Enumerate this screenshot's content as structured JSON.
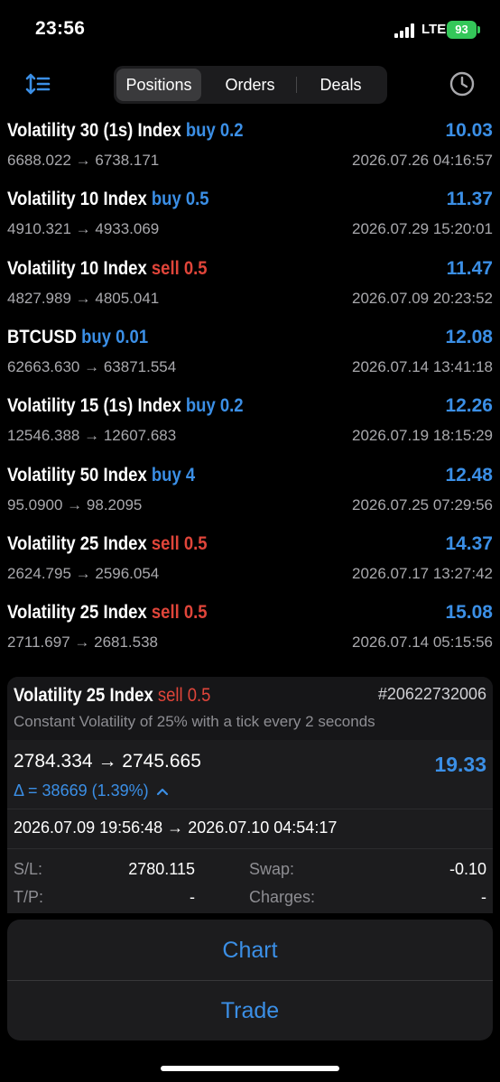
{
  "status_bar": {
    "time": "23:56",
    "network": "LTE",
    "battery": "93"
  },
  "tabs": {
    "positions": "Positions",
    "orders": "Orders",
    "deals": "Deals",
    "active": "positions"
  },
  "positions": [
    {
      "symbol": "Volatility 30 (1s) Index",
      "dir": "buy",
      "dir_label": "buy 0.2",
      "open": "6688.022",
      "current": "6738.171",
      "profit": "10.03",
      "datetime": "2026.07.26 04:16:57"
    },
    {
      "symbol": "Volatility 10 Index",
      "dir": "buy",
      "dir_label": "buy 0.5",
      "open": "4910.321",
      "current": "4933.069",
      "profit": "11.37",
      "datetime": "2026.07.29 15:20:01"
    },
    {
      "symbol": "Volatility 10 Index",
      "dir": "sell",
      "dir_label": "sell 0.5",
      "open": "4827.989",
      "current": "4805.041",
      "profit": "11.47",
      "datetime": "2026.07.09 20:23:52"
    },
    {
      "symbol": "BTCUSD",
      "dir": "buy",
      "dir_label": "buy 0.01",
      "open": "62663.630",
      "current": "63871.554",
      "profit": "12.08",
      "datetime": "2026.07.14 13:41:18"
    },
    {
      "symbol": "Volatility 15 (1s) Index",
      "dir": "buy",
      "dir_label": "buy 0.2",
      "open": "12546.388",
      "current": "12607.683",
      "profit": "12.26",
      "datetime": "2026.07.19 18:15:29"
    },
    {
      "symbol": "Volatility 50 Index",
      "dir": "buy",
      "dir_label": "buy 4",
      "open": "95.0900",
      "current": "98.2095",
      "profit": "12.48",
      "datetime": "2026.07.25 07:29:56"
    },
    {
      "symbol": "Volatility 25 Index",
      "dir": "sell",
      "dir_label": "sell 0.5",
      "open": "2624.795",
      "current": "2596.054",
      "profit": "14.37",
      "datetime": "2026.07.17 13:27:42"
    },
    {
      "symbol": "Volatility 25 Index",
      "dir": "sell",
      "dir_label": "sell 0.5",
      "open": "2711.697",
      "current": "2681.538",
      "profit": "15.08",
      "datetime": "2026.07.14 05:15:56"
    }
  ],
  "detail": {
    "symbol": "Volatility 25 Index",
    "dir": "sell",
    "dir_label": "sell 0.5",
    "ticket": "#20622732006",
    "description": "Constant Volatility of 25% with a tick every 2 seconds",
    "open_price": "2784.334",
    "current_price": "2745.665",
    "profit": "19.33",
    "delta": "Δ = 38669 (1.39%)",
    "open_time": "2026.07.09 19:56:48",
    "close_time": "2026.07.10 04:54:17",
    "sl_label": "S/L:",
    "sl_value": "2780.115",
    "tp_label": "T/P:",
    "tp_value": "-",
    "swap_label": "Swap:",
    "swap_value": "-0.10",
    "charges_label": "Charges:",
    "charges_value": "-"
  },
  "actions": {
    "chart": "Chart",
    "trade": "Trade"
  },
  "colors": {
    "accent": "#3b8fe6",
    "sell": "#e0453a",
    "battery": "#34c759"
  }
}
